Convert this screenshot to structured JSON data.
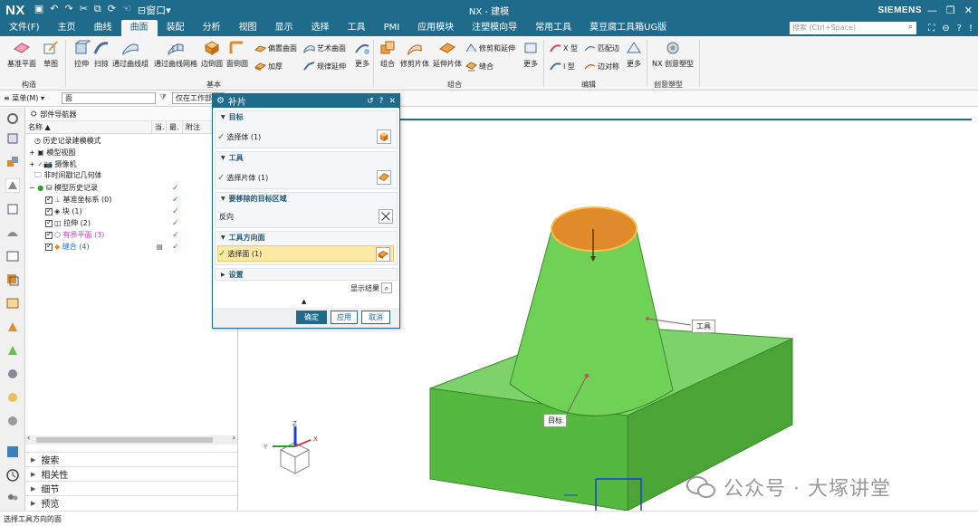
{
  "titlebar": {
    "logo": "NX",
    "window_title": "NX - 建模",
    "brand": "SIEMENS",
    "quick_window_menu": "窗口"
  },
  "menubar": {
    "items": [
      "文件(F)",
      "主页",
      "曲线",
      "曲面",
      "装配",
      "分析",
      "视图",
      "显示",
      "选择",
      "工具",
      "PMI",
      "应用模块",
      "注塑模向导",
      "常用工具",
      "莫豆腐工具箱UG版"
    ],
    "active_index": 3,
    "search_placeholder": "搜索 (Ctrl+Space)"
  },
  "ribbon": {
    "big_buttons": [
      "基准平面",
      "草图",
      "拉伸",
      "扫掠",
      "通过曲线组",
      "通过曲线网格",
      "边倒圆",
      "面倒圆",
      "组合",
      "修剪片体",
      "延伸片体",
      "NX 创意塑型"
    ],
    "small_buttons": {
      "offset_surface": "偏置曲面",
      "art_surface": "艺术曲面",
      "thicken": "加厚",
      "law_extension": "规律延伸",
      "trim_extend": "修剪和延伸",
      "stitch": "缝合",
      "x_form": "X 型",
      "match_edge": "匹配边",
      "i_form": "I 型",
      "edge_symmetry": "边对称"
    },
    "more_label": "更多",
    "groups": [
      "构造",
      "基本",
      "组合",
      "编辑",
      "创意塑型"
    ]
  },
  "selbar": {
    "menu_label": "菜单(M)",
    "filter_value": "面",
    "scope_value": "仅在工作部"
  },
  "navigator": {
    "title": "部件导航器",
    "columns": [
      "名称",
      "当.",
      "最.",
      "附注"
    ],
    "rows": [
      {
        "label": "历史记录建模模式",
        "checked": false,
        "green": false
      },
      {
        "label": "模型视图",
        "checked": false,
        "green": false
      },
      {
        "label": "摄像机",
        "checked": false,
        "green": false
      },
      {
        "label": "非时间戳记几何体",
        "checked": false,
        "green": false
      },
      {
        "label": "模型历史记录",
        "checked": false,
        "green": true
      },
      {
        "label": "基准坐标系 (0)",
        "checked": true,
        "green": true
      },
      {
        "label": "块 (1)",
        "checked": true,
        "green": true
      },
      {
        "label": "拉伸 (2)",
        "checked": true,
        "green": true
      },
      {
        "label": "有界平面 (3)",
        "checked": true,
        "green": true
      },
      {
        "label": "缝合 (4)",
        "checked": true,
        "green": true
      }
    ],
    "sections": [
      "搜索",
      "相关性",
      "细节",
      "预览"
    ]
  },
  "dialog": {
    "title": "补片",
    "target_header": "目标",
    "target_select": "选择体 (1)",
    "tool_header": "工具",
    "tool_select": "选择片体 (1)",
    "remove_region_header": "要移除的目标区域",
    "reverse_label": "反向",
    "tool_direction_header": "工具方向面",
    "tool_direction_select": "选择面 (1)",
    "settings_header": "设置",
    "show_results": "显示结果",
    "ok": "确定",
    "apply": "应用",
    "cancel": "取消"
  },
  "viewport": {
    "tool_label": "工具",
    "target_label": "目标",
    "axis_x": "X",
    "axis_y": "Y",
    "axis_z": "Z",
    "watermark": "公众号 · 大塚讲堂"
  },
  "status": "选择工具方向的面",
  "colors": {
    "accent": "#1e6b8c",
    "model_green": "#5fc24a",
    "tool_face_orange": "#e08a2a",
    "highlight_row": "#fde9a6"
  }
}
